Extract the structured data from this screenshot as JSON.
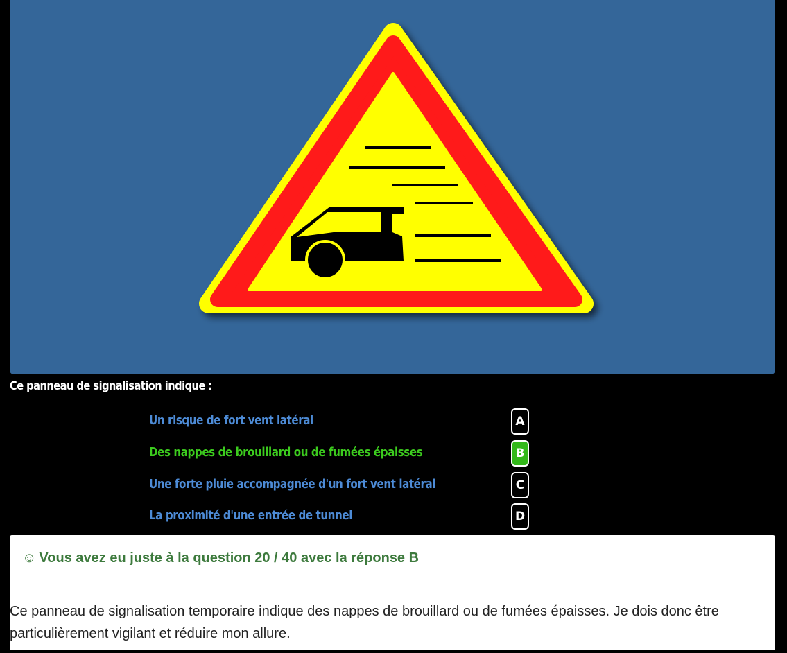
{
  "sign": {
    "colors": {
      "background": "#346699",
      "border_outer": "#ffff00",
      "border_red": "#ff1a1a",
      "inner_fill": "#ffff00",
      "symbol": "#000000"
    },
    "icon": "fog-warning-triangle-sign"
  },
  "question": {
    "text": "Ce panneau de signalisation indique :"
  },
  "answers": [
    {
      "key": "A",
      "text": "Un risque de fort vent latéral",
      "correct": false
    },
    {
      "key": "B",
      "text": "Des nappes de brouillard ou de fumées épaisses",
      "correct": true
    },
    {
      "key": "C",
      "text": "Une forte pluie accompagnée d'un fort vent latéral",
      "correct": false
    },
    {
      "key": "D",
      "text": "La proximité d'une entrée de tunnel",
      "correct": false
    }
  ],
  "feedback": {
    "icon": "smiley-icon",
    "smile": "☺",
    "title": "Vous avez eu juste à la question 20 / 40 avec la réponse B",
    "explanation": "Ce panneau de signalisation temporaire indique des nappes de brouillard ou de fumées épaisses. Je dois donc être particulièrement vigilant et réduire mon allure."
  },
  "colors": {
    "answer_default": "#4d8bd6",
    "answer_correct": "#3ccc1e",
    "feedback_title": "#3d7a3d"
  }
}
